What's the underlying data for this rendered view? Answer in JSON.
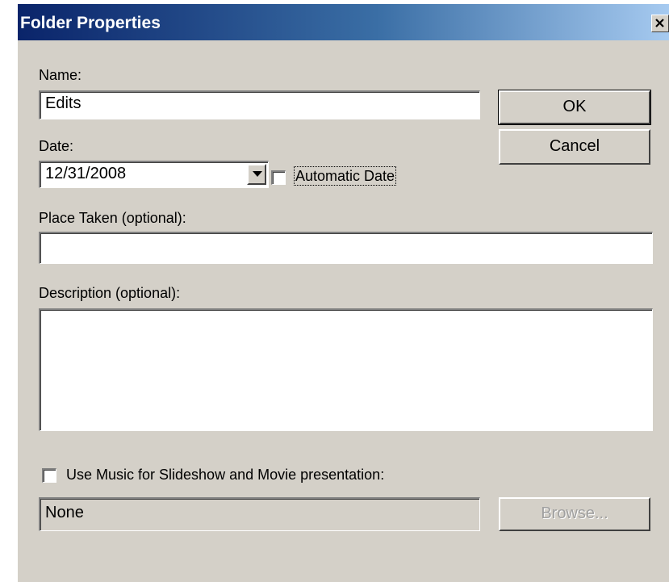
{
  "window": {
    "title": "Folder Properties",
    "close_glyph": "close-icon"
  },
  "form": {
    "name_label": "Name:",
    "name_value": "Edits",
    "date_label": "Date:",
    "date_value": "12/31/2008",
    "automatic_date_label": "Automatic Date",
    "automatic_date_checked": false,
    "place_label": "Place Taken (optional):",
    "place_value": "",
    "description_label": "Description (optional):",
    "description_value": "",
    "music_label": "Use Music for Slideshow and Movie presentation:",
    "music_checked": false,
    "music_value": "None"
  },
  "buttons": {
    "ok": "OK",
    "cancel": "Cancel",
    "browse": "Browse..."
  },
  "colors": {
    "dialog_face": "#d4d0c8",
    "titlebar_start": "#0a246a",
    "titlebar_end": "#a6caf0",
    "disabled_text": "#a0a0a0"
  }
}
